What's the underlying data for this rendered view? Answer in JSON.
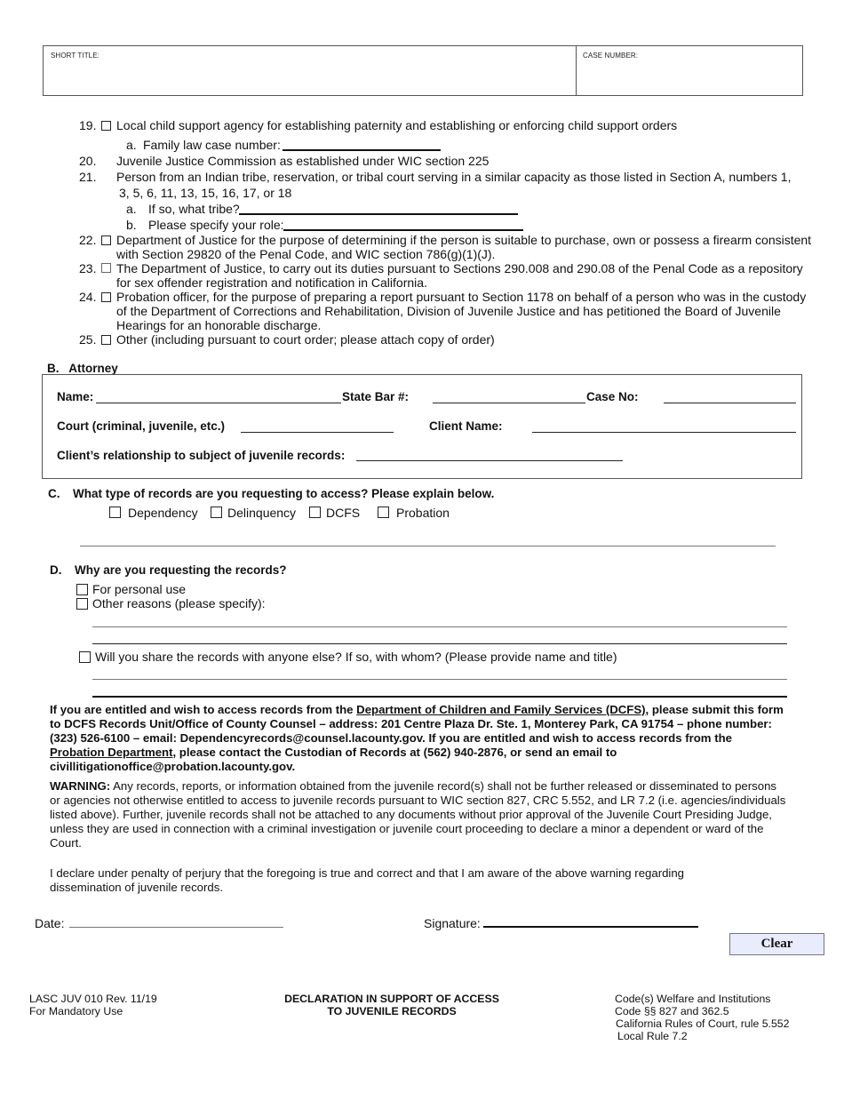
{
  "header": {
    "short_title_label": "SHORT TITLE:",
    "short_title_value": "",
    "case_number_label": "CASE NUMBER:",
    "case_number_value": ""
  },
  "section_a_items": {
    "item19": {
      "number": "19.",
      "text": "Local child support agency for establishing paternity and establishing or enforcing child support orders",
      "checked": false
    },
    "item19a": {
      "label": "a.",
      "text": "Family law case number:",
      "value": ""
    },
    "item20": {
      "number": "20.",
      "text": "Juvenile Justice Commission as established under WIC section 225"
    },
    "item21": {
      "number": "21.",
      "text_line1": "Person from an Indian tribe, reservation, or tribal court serving in a similar capacity as those listed in Section A, numbers 1,",
      "text_line2": "3, 5, 6, 11, 13, 15, 16, 17, or 18"
    },
    "item21a": {
      "label": "a.",
      "text": "If so, what tribe?",
      "value": ""
    },
    "item21b": {
      "label": "b.",
      "text": "Please specify your role:",
      "value": ""
    },
    "item22": {
      "number": "22.",
      "text_line1": "Department of Justice for the purpose of determining if the person is suitable to purchase, own or possess a firearm consistent",
      "text_line2": "with Section 29820 of the Penal Code, and WIC section 786(g)(1)(J).",
      "checked": false
    },
    "item23": {
      "number": "23.",
      "text_line1": "The Department of Justice, to carry out its duties pursuant to Sections 290.008 and 290.08 of the Penal Code as a repository",
      "text_line2": "for sex offender registration and notification in California.",
      "checked": false
    },
    "item24": {
      "number": "24.",
      "text_line1": "Probation officer, for the purpose of preparing a report pursuant to Section 1178 on behalf of a person who was in the custody",
      "text_line2": "of the Department of Corrections and Rehabilitation, Division of Juvenile Justice and has petitioned the Board of Juvenile",
      "text_line3": "Hearings for an honorable discharge.",
      "checked": false
    },
    "item25": {
      "number": "25.",
      "text": "Other (including pursuant to court order; please attach copy of order)",
      "checked": false
    }
  },
  "section_b": {
    "heading": "B.   Attorney",
    "name_label": "Name:",
    "name_value": "",
    "state_bar_label": "State Bar #:",
    "state_bar_value": "",
    "case_no_label": "Case No:",
    "case_no_value": "",
    "court_label": "Court (criminal, juvenile, etc.)",
    "court_value": "",
    "client_name_label": "Client Name:",
    "client_name_value": "",
    "relationship_label": "Client’s relationship to subject of juvenile records:",
    "relationship_value": ""
  },
  "section_c": {
    "letter": "C.",
    "question": "What type of records are you requesting to access? Please explain below.",
    "options": [
      {
        "label": "Dependency",
        "checked": false
      },
      {
        "label": "Delinquency",
        "checked": false
      },
      {
        "label": "DCFS",
        "checked": false
      },
      {
        "label": "Probation",
        "checked": false
      }
    ],
    "explanation": ""
  },
  "section_d": {
    "letter": "D.",
    "question": "Why are you requesting the records?",
    "options": [
      {
        "label": "For personal use",
        "checked": false
      },
      {
        "label": "Other reasons (please specify):",
        "checked": false
      }
    ],
    "other_reasons_value": "",
    "share_question": "Will you share the records with anyone else? If so, with whom? (Please provide name and title)",
    "share_checked": false,
    "share_value": ""
  },
  "instructions": {
    "p1_a": "If you are entitled and wish to access records from the ",
    "p1_link1": "Department of Children and Family Services (DCFS)",
    "p1_b": ", please submit this form to DCFS Records Unit/Office of County Counsel – address: 201 Centre Plaza Dr. Ste. 1, Monterey Park, CA 91754 – phone number: (323) 526-6100 – email: Dependencyrecords@counsel.lacounty.gov. If you are entitled and wish to access records from the ",
    "p1_link2": "Probation Department",
    "p1_c": ", please contact the Custodian of Records at (562) 940-2876, or send an email to civillitigationoffice@probation.lacounty.gov.",
    "warning_label": "WARNING:",
    "warning_text": " Any records, reports, or information obtained from the juvenile record(s) shall not be further released or disseminated to persons or agencies not otherwise entitled to access to juvenile records pursuant to WIC section 827, CRC 5.552, and LR 7.2 (i.e. agencies/individuals listed above). Further, juvenile records shall not be attached to any documents without prior approval of the Juvenile Court Presiding Judge, unless they are used in connection with a criminal investigation or juvenile court proceeding to declare a minor a dependent or ward of the Court.",
    "declaration": "I declare under penalty of perjury that the foregoing is true and correct and that I am aware of the above warning regarding dissemination of juvenile records."
  },
  "signature": {
    "date_label": "Date:",
    "date_value": "",
    "signature_label": "Signature:",
    "signature_value": "",
    "clear_button": "Clear"
  },
  "footer": {
    "form_id": "LASC JUV 010 Rev. 11/19",
    "mandatory": "For Mandatory Use",
    "title_line1": "DECLARATION IN SUPPORT OF ACCESS",
    "title_line2": "TO JUVENILE RECORDS",
    "code_line1": "Code(s) Welfare and Institutions",
    "code_line2": "Code §§ 827 and 362.5",
    "code_line3": "California Rules of Court, rule 5.552",
    "code_line4": "Local Rule 7.2"
  }
}
